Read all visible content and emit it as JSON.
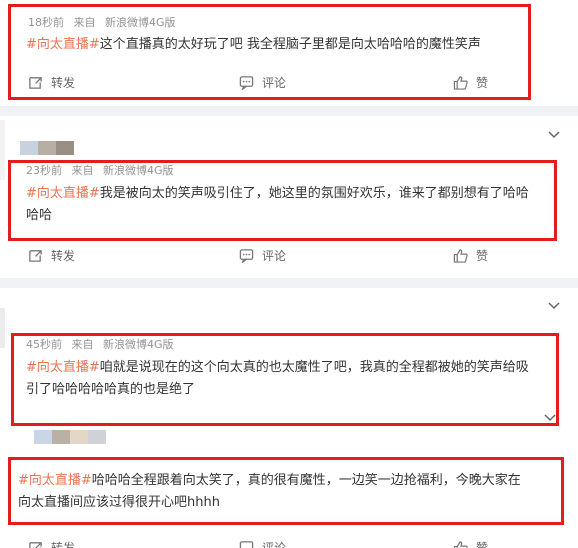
{
  "posts": [
    {
      "meta": {
        "time": "18秒前",
        "source_prefix": "来自",
        "source": "新浪微博4G版"
      },
      "topic": "#向太直播#",
      "text": "这个直播真的太好玩了吧 我全程脑子里都是向太哈哈哈的魔性笑声",
      "actions": {
        "repost": "转发",
        "comment": "评论",
        "like": "赞"
      }
    },
    {
      "meta": {
        "time": "23秒前",
        "source_prefix": "来自",
        "source": "新浪微博4G版"
      },
      "topic": "#向太直播#",
      "text": "我是被向太的笑声吸引住了，她这里的氛围好欢乐，谁来了都别想有了哈哈",
      "text2": "哈哈",
      "actions": {
        "repost": "转发",
        "comment": "评论",
        "like": "赞"
      }
    },
    {
      "meta": {
        "time": "45秒前",
        "source_prefix": "来自",
        "source": "新浪微博4G版"
      },
      "topic": "#向太直播#",
      "text": "咱就是说现在的这个向太真的也太魔性了吧，我真的全程都被她的笑声给吸",
      "text2": "引了哈哈哈哈哈真的也是绝了"
    },
    {
      "topic": "#向太直播#",
      "text": "哈哈哈全程跟着向太笑了，真的很有魔性，一边笑一边抢福利，今晚大家在",
      "text2": "向太直播间应该过得很开心吧hhhh",
      "actions": {
        "repost": "转发",
        "comment": "评论",
        "like": "赞"
      }
    }
  ],
  "colors": {
    "topic": "#eb7350",
    "highlight_box": "#e41c1c",
    "meta": "#939393",
    "separator": "#f1f2f5"
  },
  "icons": [
    "repost-icon",
    "comment-icon",
    "like-icon",
    "chevron-down-icon"
  ]
}
